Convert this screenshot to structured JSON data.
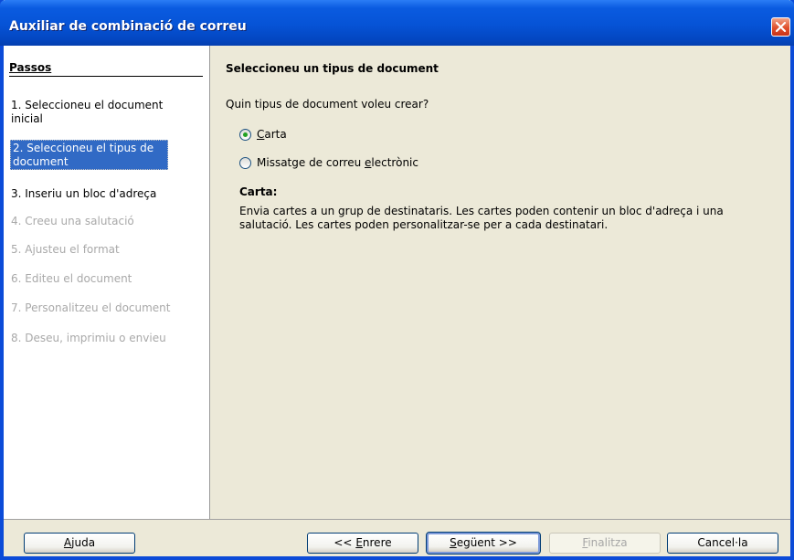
{
  "window": {
    "title": "Auxiliar de combinació de correu"
  },
  "steps": {
    "heading": "Passos",
    "items": [
      {
        "label": "1. Seleccioneu el document inicial",
        "state": "enabled"
      },
      {
        "label": "2. Seleccioneu el tipus de document",
        "state": "active"
      },
      {
        "label": "3. Inseriu un bloc d'adreça",
        "state": "enabled"
      },
      {
        "label": "4. Creeu una salutació",
        "state": "disabled"
      },
      {
        "label": "5. Ajusteu el format",
        "state": "disabled"
      },
      {
        "label": "6. Editeu el document",
        "state": "disabled"
      },
      {
        "label": "7. Personalitzeu el document",
        "state": "disabled"
      },
      {
        "label": "8. Deseu, imprimiu o envieu",
        "state": "disabled"
      }
    ]
  },
  "content": {
    "heading": "Seleccioneu un tipus de document",
    "question": "Quin tipus de document voleu crear?",
    "options": [
      {
        "accel": "C",
        "rest": "arta",
        "checked": true
      },
      {
        "prefix": "Missatge de correu ",
        "accel": "e",
        "rest": "lectrònic",
        "checked": false
      }
    ],
    "description_title": "Carta:",
    "description": "Envia cartes a un grup de destinataris. Les cartes poden contenir un bloc d'adreça i una salutació. Les cartes poden personalitzar-se per a cada destinatari."
  },
  "buttons": {
    "help": {
      "accel": "A",
      "rest": "juda"
    },
    "back": {
      "prefix": "<< ",
      "accel": "E",
      "rest": "nrere"
    },
    "next": {
      "accel": "S",
      "rest": "egüent >>"
    },
    "finish": {
      "accel": "F",
      "rest": "inalitza"
    },
    "cancel": {
      "label": "Cancel·la"
    }
  },
  "colors": {
    "titlebar": "#0653D6",
    "selection": "#316AC5",
    "dialog_bg": "#ECE9D8",
    "radio_dot": "#21A121",
    "close_button": "#E0502C"
  }
}
